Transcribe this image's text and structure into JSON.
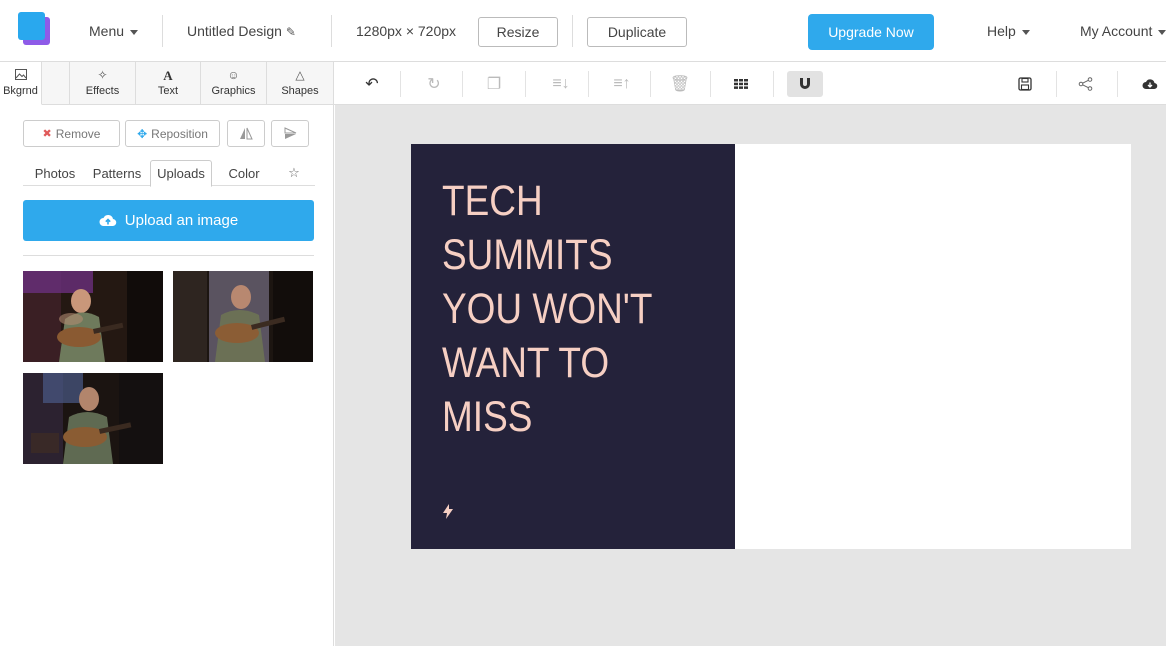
{
  "app": {
    "menu_label": "Menu",
    "design_title": "Untitled Design",
    "dimensions": "1280px × 720px",
    "resize_label": "Resize",
    "duplicate_label": "Duplicate",
    "upgrade_label": "Upgrade Now",
    "help_label": "Help",
    "account_label": "My Account",
    "accent_color": "#2fa9ec"
  },
  "panel_tabs": [
    {
      "label": "Bkgrnd",
      "icon": "image-icon"
    },
    {
      "label": "Effects",
      "icon": "magic-wand-icon"
    },
    {
      "label": "Text",
      "icon": "text-icon"
    },
    {
      "label": "Graphics",
      "icon": "smiley-icon"
    },
    {
      "label": "Shapes",
      "icon": "triangle-icon"
    }
  ],
  "editor_tools": [
    "undo-icon",
    "redo-icon",
    "copy-icon",
    "layer-down-icon",
    "layer-up-icon",
    "trash-icon",
    "grid-icon",
    "magnet-icon",
    "save-icon",
    "share-icon",
    "cloud-download-icon"
  ],
  "background_panel": {
    "remove_label": "Remove",
    "reposition_label": "Reposition",
    "subtabs": [
      "Photos",
      "Patterns",
      "Uploads",
      "Color"
    ],
    "active_subtab": "Uploads",
    "upload_label": "Upload an image",
    "uploads_count": 3
  },
  "design": {
    "headline": [
      "TECH",
      "SUMMITS",
      "YOU WON'T",
      "WANT TO",
      "MISS"
    ],
    "panel_color": "#24223a",
    "text_color": "#f6cfc3",
    "icon": "lightning-bolt-icon"
  }
}
